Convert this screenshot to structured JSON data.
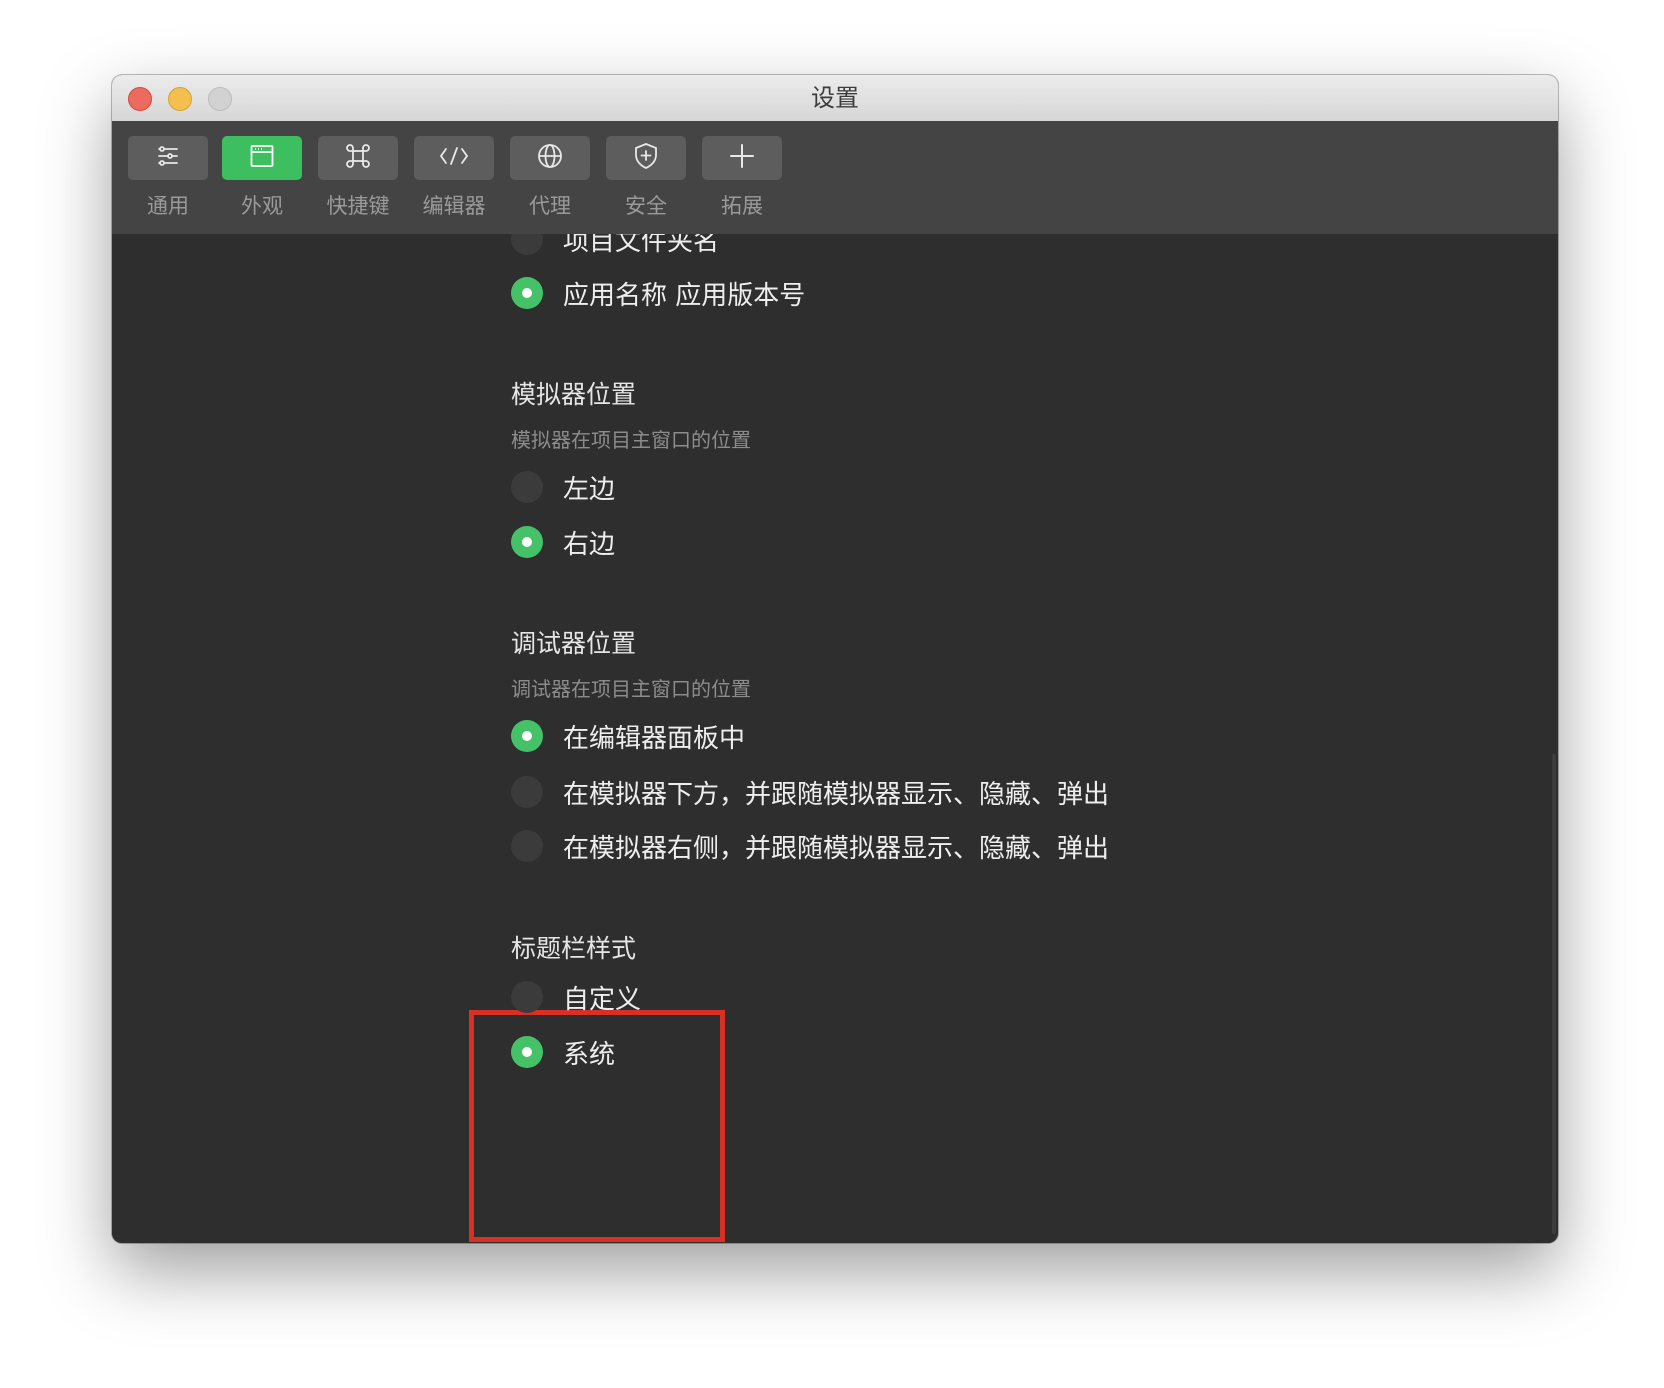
{
  "window": {
    "title": "设置"
  },
  "toolbar": {
    "items": [
      {
        "label": "通用",
        "icon": "sliders-icon"
      },
      {
        "label": "外观",
        "icon": "window-icon",
        "active": true
      },
      {
        "label": "快捷键",
        "icon": "command-icon"
      },
      {
        "label": "编辑器",
        "icon": "code-icon"
      },
      {
        "label": "代理",
        "icon": "globe-icon"
      },
      {
        "label": "安全",
        "icon": "shield-icon"
      },
      {
        "label": "拓展",
        "icon": "plus-icon"
      }
    ]
  },
  "title_display": {
    "options": [
      {
        "label": "项目文件夹名",
        "checked": false
      },
      {
        "label": "应用名称 应用版本号",
        "checked": true
      }
    ]
  },
  "simulator_position": {
    "title": "模拟器位置",
    "description": "模拟器在项目主窗口的位置",
    "options": [
      {
        "label": "左边",
        "checked": false
      },
      {
        "label": "右边",
        "checked": true
      }
    ]
  },
  "debugger_position": {
    "title": "调试器位置",
    "description": "调试器在项目主窗口的位置",
    "options": [
      {
        "label": "在编辑器面板中",
        "checked": true
      },
      {
        "label": "在模拟器下方，并跟随模拟器显示、隐藏、弹出",
        "checked": false
      },
      {
        "label": "在模拟器右侧，并跟随模拟器显示、隐藏、弹出",
        "checked": false
      }
    ]
  },
  "titlebar_style": {
    "title": "标题栏样式",
    "options": [
      {
        "label": "自定义",
        "checked": false
      },
      {
        "label": "系统",
        "checked": true
      }
    ]
  },
  "colors": {
    "accent": "#45c267",
    "background": "#2e2e2e",
    "toolbar": "#444444",
    "highlight": "#d93025"
  }
}
